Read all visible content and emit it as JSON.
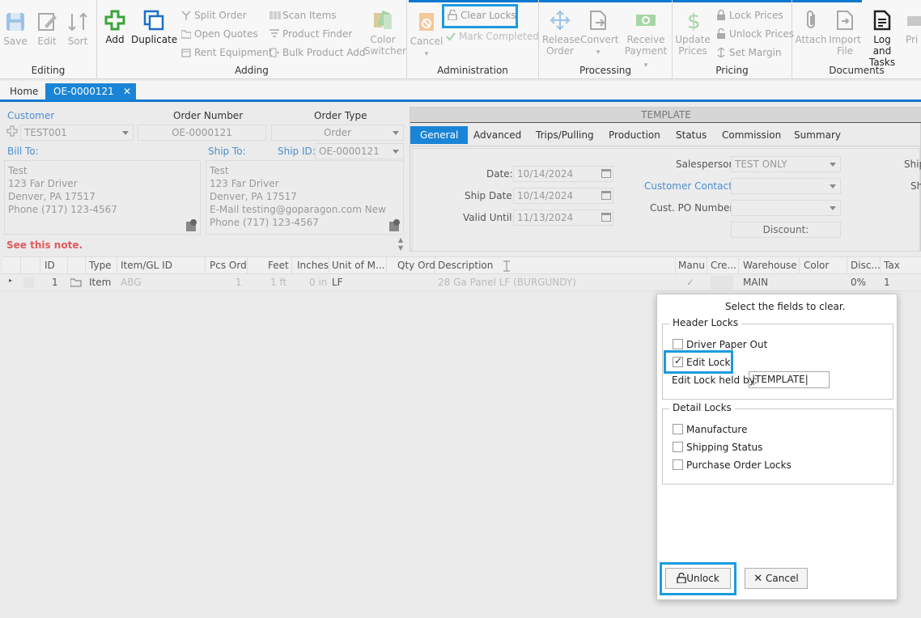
{
  "ribbon": {
    "editing": {
      "label": "Editing",
      "save": "Save",
      "edit": "Edit",
      "sort": "Sort"
    },
    "adding": {
      "label": "Adding",
      "add": "Add",
      "duplicate": "Duplicate",
      "split_order": "Split Order",
      "open_quotes": "Open Quotes",
      "rent_equipment": "Rent Equipment",
      "scan_items": "Scan Items",
      "product_finder": "Product Finder",
      "bulk_product_add": "Bulk Product Add",
      "color_switcher_1": "Color",
      "color_switcher_2": "Switcher"
    },
    "administration": {
      "label": "Administration",
      "cancel": "Cancel",
      "clear_locks": "Clear Locks",
      "mark_completed": "Mark Completed"
    },
    "processing": {
      "label": "Processing",
      "release_1": "Release",
      "release_2": "Order",
      "convert": "Convert",
      "receive_1": "Receive",
      "receive_2": "Payment"
    },
    "pricing": {
      "label": "Pricing",
      "update_1": "Update",
      "update_2": "Prices",
      "lock_prices": "Lock Prices",
      "unlock_prices": "Unlock Prices",
      "set_margin": "Set Margin"
    },
    "documents": {
      "label": "Documents",
      "attach": "Attach",
      "import_1": "Import",
      "import_2": "File",
      "log_1": "Log and",
      "log_2": "Tasks",
      "print": "Pri"
    }
  },
  "tabs": {
    "home": "Home",
    "order": "OE-0000121",
    "close": "✕"
  },
  "form": {
    "customer_label": "Customer",
    "customer_value": "TEST001",
    "order_number_label": "Order Number",
    "order_number_value": "OE-0000121",
    "order_type_label": "Order Type",
    "order_type_value": "Order",
    "bill_to_label": "Bill To:",
    "ship_to_label": "Ship To:",
    "ship_id_label": "Ship ID:",
    "ship_id_value": "OE-0000121",
    "bill_to_lines": [
      "Test",
      "123 Far Driver",
      "Denver, PA 17517",
      "Phone (717) 123-4567"
    ],
    "ship_to_lines": [
      "Test",
      "123 Far Driver",
      "Denver, PA 17517",
      "E-Mail testing@goparagon.com New",
      "Phone (717) 123-4567"
    ],
    "note": "See this note.",
    "template_header": "TEMPLATE",
    "subtabs": [
      "General",
      "Advanced",
      "Trips/Pulling",
      "Production",
      "Status",
      "Commission",
      "Summary"
    ],
    "date_label": "Date:",
    "date_value": "10/14/2024",
    "ship_date_label": "Ship Date:",
    "ship_date_value": "10/14/2024",
    "valid_until_label": "Valid Until:",
    "valid_until_value": "11/13/2024",
    "salesperson_label": "Salesperson",
    "salesperson_value": "TEST ONLY",
    "customer_contact_label": "Customer Contact:",
    "cust_po_label": "Cust. PO Number:",
    "discount_label": "Discount:",
    "ship_cut_1": "Ship",
    "ship_cut_2": "Sh"
  },
  "grid": {
    "headers": [
      "ID",
      "Type",
      "Item/GL ID",
      "Pcs Ord",
      "Feet",
      "Inches",
      "Unit of M...",
      "Qty Ord",
      "Description",
      "Manu",
      "Cre...",
      "Warehouse",
      "Color",
      "Disc...",
      "Tax"
    ],
    "row": {
      "id": "1",
      "type": "Item",
      "item": "ABG",
      "pcs": "1",
      "feet": "1 ft",
      "inches": "0 in",
      "unit": "LF",
      "qty": "",
      "description": "28 Ga Panel LF (BURGUNDY)",
      "manu": "✓",
      "warehouse": "MAIN",
      "disc": "0%",
      "tax": "1"
    }
  },
  "dialog": {
    "title": "Select the fields to clear.",
    "header_locks": "Header Locks",
    "driver_paper_out": "Driver Paper Out",
    "edit_lock": "Edit Lock",
    "edit_lock_held_by_label": "Edit Lock held by:",
    "edit_lock_held_by_value": "|TEMPLATE|",
    "detail_locks": "Detail Locks",
    "manufacture": "Manufacture",
    "shipping_status": "Shipping Status",
    "purchase_order_locks": "Purchase Order Locks",
    "unlock": "Unlock",
    "cancel": "Cancel",
    "edit_lock_checked": true
  },
  "colors": {
    "accent": "#1a85d6",
    "highlight": "#1b9be0",
    "note_red": "#e05a5a",
    "link_blue": "#4b8fd1"
  }
}
